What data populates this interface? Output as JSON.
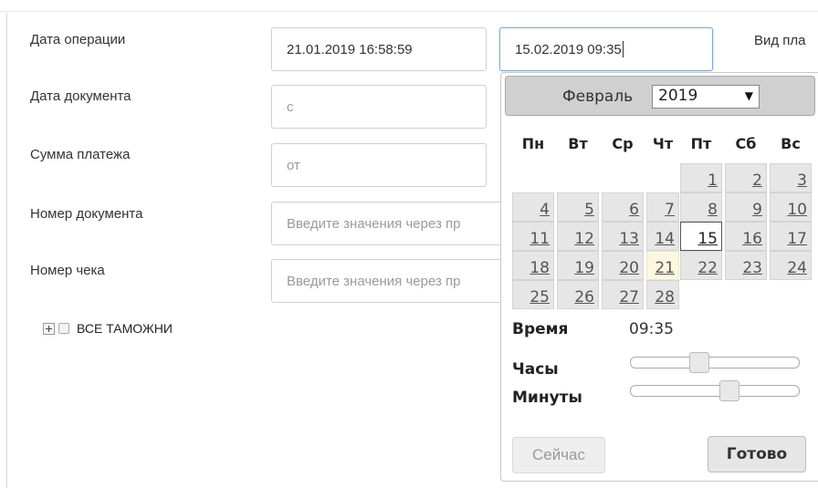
{
  "filters": {
    "operation_date_label": "Дата операции",
    "operation_date_from": "21.01.2019 16:58:59",
    "operation_date_to": "15.02.2019 09:35",
    "payment_type_label": "Вид пла",
    "document_date_label": "Дата документа",
    "document_date_placeholder": "с",
    "payment_sum_label": "Сумма платежа",
    "payment_sum_placeholder": "от",
    "document_number_label": "Номер документа",
    "document_number_placeholder": "Введите значения через пр",
    "receipt_number_label": "Номер чека",
    "receipt_number_placeholder": "Введите значения через пр"
  },
  "tree": {
    "all_customs_label": "ВСЕ ТАМОЖНИ"
  },
  "datepicker": {
    "month": "Февраль",
    "year": "2019",
    "weekdays": [
      "Пн",
      "Вт",
      "Ср",
      "Чт",
      "Пт",
      "Сб",
      "Вс"
    ],
    "days": [
      {
        "d": "1",
        "col": 4,
        "row": 0
      },
      {
        "d": "2",
        "col": 5,
        "row": 0
      },
      {
        "d": "3",
        "col": 6,
        "row": 0
      },
      {
        "d": "4",
        "col": 0,
        "row": 1
      },
      {
        "d": "5",
        "col": 1,
        "row": 1
      },
      {
        "d": "6",
        "col": 2,
        "row": 1
      },
      {
        "d": "7",
        "col": 3,
        "row": 1
      },
      {
        "d": "8",
        "col": 4,
        "row": 1
      },
      {
        "d": "9",
        "col": 5,
        "row": 1
      },
      {
        "d": "10",
        "col": 6,
        "row": 1
      },
      {
        "d": "11",
        "col": 0,
        "row": 2
      },
      {
        "d": "12",
        "col": 1,
        "row": 2
      },
      {
        "d": "13",
        "col": 2,
        "row": 2
      },
      {
        "d": "14",
        "col": 3,
        "row": 2
      },
      {
        "d": "15",
        "col": 4,
        "row": 2,
        "state": "selected"
      },
      {
        "d": "16",
        "col": 5,
        "row": 2
      },
      {
        "d": "17",
        "col": 6,
        "row": 2
      },
      {
        "d": "18",
        "col": 0,
        "row": 3
      },
      {
        "d": "19",
        "col": 1,
        "row": 3
      },
      {
        "d": "20",
        "col": 2,
        "row": 3
      },
      {
        "d": "21",
        "col": 3,
        "row": 3,
        "state": "today"
      },
      {
        "d": "22",
        "col": 4,
        "row": 3
      },
      {
        "d": "23",
        "col": 5,
        "row": 3
      },
      {
        "d": "24",
        "col": 6,
        "row": 3
      },
      {
        "d": "25",
        "col": 0,
        "row": 4
      },
      {
        "d": "26",
        "col": 1,
        "row": 4
      },
      {
        "d": "27",
        "col": 2,
        "row": 4
      },
      {
        "d": "28",
        "col": 3,
        "row": 4
      }
    ],
    "time_label": "Время",
    "time_value": "09:35",
    "hours_label": "Часы",
    "hours_value": 9,
    "hours_max": 23,
    "minutes_label": "Минуты",
    "minutes_value": 35,
    "minutes_max": 59,
    "now_button": "Сейчас",
    "done_button": "Готово"
  }
}
